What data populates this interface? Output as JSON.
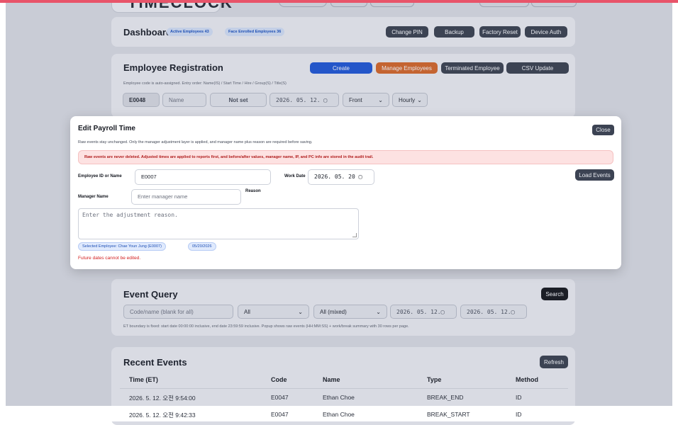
{
  "app": {
    "logo": "TIMECLOCK"
  },
  "dashboard": {
    "title": "Dashboard",
    "active_badge": "Active Employees 43",
    "face_badge": "Face Enrolled Employees 36",
    "buttons": [
      "Change PIN",
      "Backup",
      "Factory Reset",
      "Device Auth"
    ]
  },
  "registration": {
    "title": "Employee Registration",
    "buttons": {
      "create": "Create",
      "manage": "Manage Employees",
      "terminated": "Terminated Employee",
      "csv": "CSV Update"
    },
    "note": "Employee code is auto-assigned. Entry order: Name(IS) / Start Time / Hire / Group(S) / Title(S)",
    "code": "E0048",
    "name_placeholder": "Name",
    "not_set": "Not set",
    "date": "2026. 05. 12. ▢",
    "side": "Front",
    "pay": "Hourly"
  },
  "modal": {
    "title": "Edit Payroll Time",
    "close": "Close",
    "subtitle": "Raw events stay unchanged. Only the manager adjustment layer is applied, and manager name plus reason are required before saving.",
    "alert": "Raw events are never deleted. Adjusted times are applied to reports first, and before/after values, manager name, IP, and PC info are stored in the audit trail.",
    "employee_label": "Employee ID or Name",
    "employee_value": "E0007",
    "work_date_label": "Work Date",
    "work_date_value": "2026. 05. 20 ▢",
    "load_events": "Load Events",
    "manager_label": "Manager Name",
    "manager_placeholder": "Enter manager name",
    "reason_label": "Reason",
    "reason_placeholder": "Enter the adjustment reason.",
    "selected_employee": "Selected Employee: Chae Youn Jung (E0007)",
    "selected_date": "05/20/2026",
    "error": "Future dates cannot be edited."
  },
  "event_query": {
    "title": "Event Query",
    "search": "Search",
    "code_placeholder": "Code/name (blank for all)",
    "filter1": "All",
    "filter2": "All (mixed)",
    "start_date": "2026. 05. 12.▢",
    "end_date": "2026. 05. 12.▢",
    "note": "ET boundary is fixed: start date 00:00:00 inclusive, end date 23:59:59 inclusive. Popup shows raw events (HH:MM:SS) + work/break summary with 30 rows per page."
  },
  "recent_events": {
    "title": "Recent Events",
    "refresh": "Refresh",
    "columns": [
      "Time (ET)",
      "Code",
      "Name",
      "Type",
      "Method"
    ],
    "rows": [
      [
        "2026. 5. 12. 오전 9:54:00",
        "E0047",
        "Ethan Choe",
        "BREAK_END",
        "ID"
      ],
      [
        "2026. 5. 12. 오전 9:42:33",
        "E0047",
        "Ethan Choe",
        "BREAK_START",
        "ID"
      ]
    ]
  },
  "colors": {
    "backdrop": "#c9ccd6",
    "create_blue": "#2456c9",
    "manage_orange": "#c46431",
    "dark_button": "#3c4353",
    "alert_red": "#b01c1c",
    "error_red": "#d32020"
  }
}
